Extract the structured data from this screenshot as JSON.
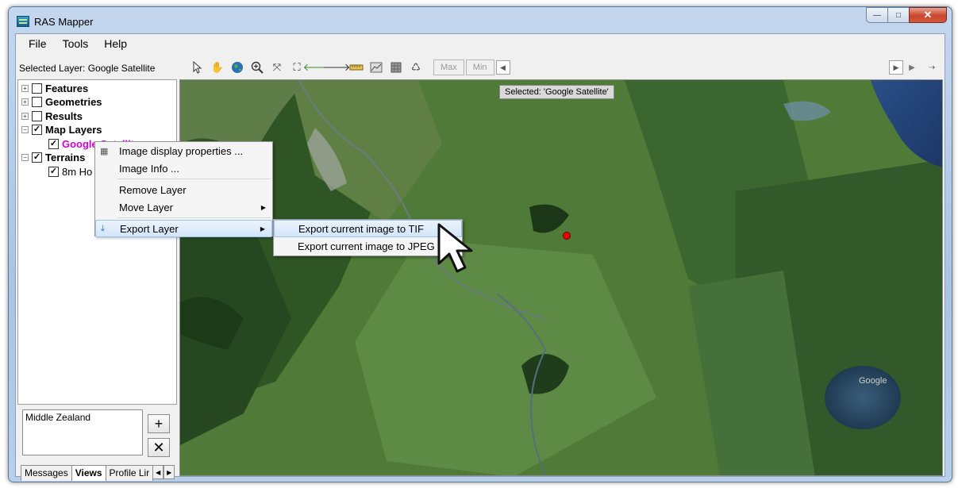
{
  "window": {
    "title": "RAS Mapper",
    "controls": [
      "—",
      "□",
      "✕"
    ]
  },
  "menu": [
    "File",
    "Tools",
    "Help"
  ],
  "selected_layer_text": "Selected Layer: Google Satellite",
  "toolbar": {
    "max_label": "Max",
    "min_label": "Min"
  },
  "tree": {
    "features": "Features",
    "geometries": "Geometries",
    "results": "Results",
    "map_layers": "Map Layers",
    "google_satellite": "Google Satellite",
    "terrains": "Terrains",
    "terrain_item": "8m Ho"
  },
  "view_list": {
    "item": "Middle Zealand",
    "add": "+",
    "remove": "✕"
  },
  "tabs": [
    "Messages",
    "Views",
    "Profile Lir"
  ],
  "map": {
    "selected_label": "Selected: 'Google Satellite'",
    "watermark": "Google"
  },
  "context_menu": {
    "image_display_properties": "Image display properties ...",
    "image_info": "Image Info ...",
    "remove_layer": "Remove Layer",
    "move_layer": "Move Layer",
    "export_layer": "Export Layer"
  },
  "submenu": {
    "export_tif": "Export current image to TIF",
    "export_jpeg": "Export current image to JPEG"
  }
}
